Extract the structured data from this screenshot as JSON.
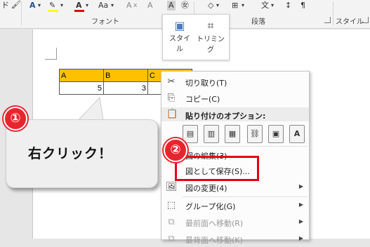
{
  "ribbon": {
    "left_fragment": "ド",
    "font_group_label": "フォント",
    "paragraph_group_label": "段落",
    "style_group_label": "スタイル",
    "font_size_letter": "Aa",
    "text_color_letter": "A",
    "highlight_letter": "A"
  },
  "picture_tools": {
    "style_label": "スタイル",
    "trim_label": "トリミング"
  },
  "table": {
    "headers": [
      "A",
      "B",
      "C"
    ],
    "values": [
      "5",
      "3",
      ""
    ],
    "header_color": "#ffc000"
  },
  "callout": {
    "text": "右クリック！"
  },
  "badges": {
    "one": "①",
    "two": "②",
    "color": "#e8252e"
  },
  "context_menu": {
    "cut": "切り取り(T)",
    "copy": "コピー(C)",
    "paste_options": "貼り付けのオプション:",
    "paste_icon_count_label": "",
    "edit_picture": "図の編集(3)",
    "save_as_picture": "図として保存(S)...",
    "change_picture": "図の変更(4)",
    "group": "グループ化(G)",
    "bring_to_front": "最前面へ移動(R)",
    "send_to_back": "最背面へ移動(K)"
  },
  "highlight_color": "#e60012"
}
